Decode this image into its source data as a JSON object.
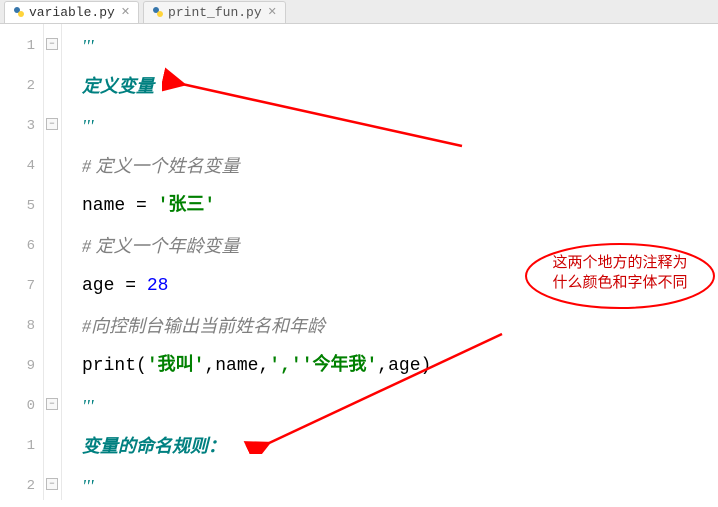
{
  "tabs": [
    {
      "label": "variable.py",
      "active": true
    },
    {
      "label": "print_fun.py",
      "active": false
    }
  ],
  "gutter_numbers": [
    "1",
    "2",
    "3",
    "4",
    "5",
    "6",
    "7",
    "8",
    "9",
    "0",
    "1",
    "2"
  ],
  "code": {
    "l1_quote": "'''",
    "l2_docstring": "定义变量",
    "l3_quote": "'''",
    "l4_comment": "#  定义一个姓名变量",
    "l5_name": "name",
    "l5_eq": " = ",
    "l5_str": "'张三'",
    "l6_comment": "#  定义一个年龄变量",
    "l7_age": "age",
    "l7_eq": " = ",
    "l7_num": "28",
    "l8_comment": "#向控制台输出当前姓名和年龄",
    "l9_func": "print",
    "l9_p1": "(",
    "l9_s1": "'我叫'",
    "l9_c1": ",",
    "l9_v1": "name",
    "l9_c2": ",",
    "l9_s2": "','",
    "l9_s3": "'今年我'",
    "l9_c3": ",",
    "l9_v2": "age",
    "l9_p2": ")",
    "l10_quote": "'''",
    "l11_docstring": "变量的命名规则：",
    "l12_quote": "'''"
  },
  "annotation": {
    "text_line1": "这两个地方的注释为",
    "text_line2": "什么颜色和字体不同"
  }
}
